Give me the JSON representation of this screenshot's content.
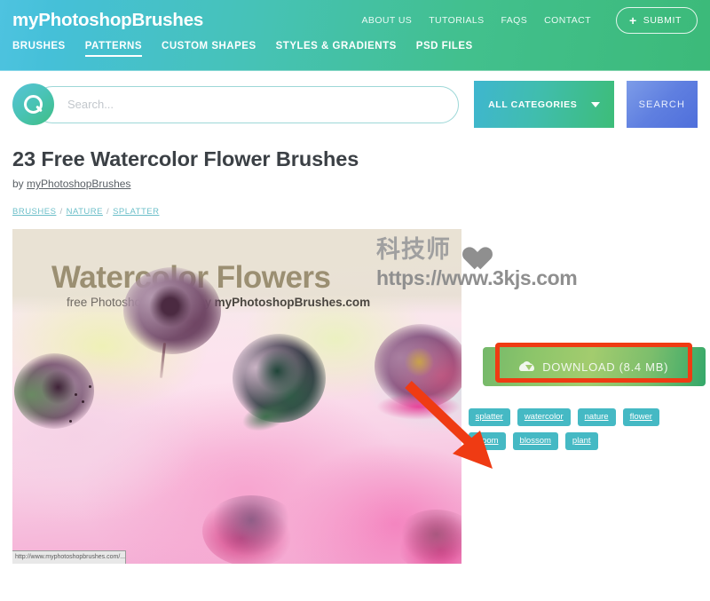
{
  "header": {
    "brand": "myPhotoshopBrushes",
    "top_nav": [
      {
        "label": "ABOUT US"
      },
      {
        "label": "TUTORIALS"
      },
      {
        "label": "FAQS"
      },
      {
        "label": "CONTACT"
      }
    ],
    "submit_button": {
      "label": "SUBMIT",
      "icon": "plus-icon"
    },
    "main_nav": [
      {
        "label": "BRUSHES",
        "active": false
      },
      {
        "label": "PATTERNS",
        "active": true
      },
      {
        "label": "CUSTOM SHAPES",
        "active": false
      },
      {
        "label": "STYLES & GRADIENTS",
        "active": false
      },
      {
        "label": "PSD FILES",
        "active": false
      }
    ],
    "gradient_from": "#4ec3e0",
    "gradient_to": "#3cba79"
  },
  "search": {
    "placeholder": "Search...",
    "value": "",
    "icon": "search-icon",
    "category_label": "ALL CATEGORIES",
    "category_caret": "chevron-down-icon",
    "search_button_label": "SEARCH",
    "category_color": "#3dbd79",
    "search_button_color": "#5f7fe0"
  },
  "article": {
    "title": "23 Free Watercolor Flower Brushes",
    "by_prefix": "by ",
    "author": "myPhotoshopBrushes",
    "breadcrumb": [
      {
        "label": "BRUSHES"
      },
      {
        "label": "NATURE"
      },
      {
        "label": "SPLATTER"
      }
    ],
    "breadcrumb_separator": "/"
  },
  "preview": {
    "title": "Watercolor Flowers",
    "subtitle_prefix": "free Photoshop Brushes by ",
    "subtitle_brand": "myPhotoshopBrushes.com"
  },
  "download": {
    "label": "DOWNLOAD (8.4 MB)",
    "icon": "cloud-download-icon",
    "button_color": "#8cc56a",
    "highlight_color": "#ef3b13"
  },
  "tags": [
    {
      "label": "splatter"
    },
    {
      "label": "watercolor"
    },
    {
      "label": "nature"
    },
    {
      "label": "flower"
    },
    {
      "label": "bloom"
    },
    {
      "label": "blossom"
    },
    {
      "label": "plant"
    }
  ],
  "tag_color": "#45b9c4",
  "watermark": {
    "text_cn": "科技师",
    "icon": "heart-icon",
    "url": "https://www.3kjs.com",
    "color": "#8f8f8f"
  },
  "status_bar": {
    "text": "http://www.myphotoshopbrushes.com/..."
  },
  "annotation": {
    "arrow_color": "#ef3b13",
    "arrow_icon": "arrow-pointing-down-right-icon"
  }
}
